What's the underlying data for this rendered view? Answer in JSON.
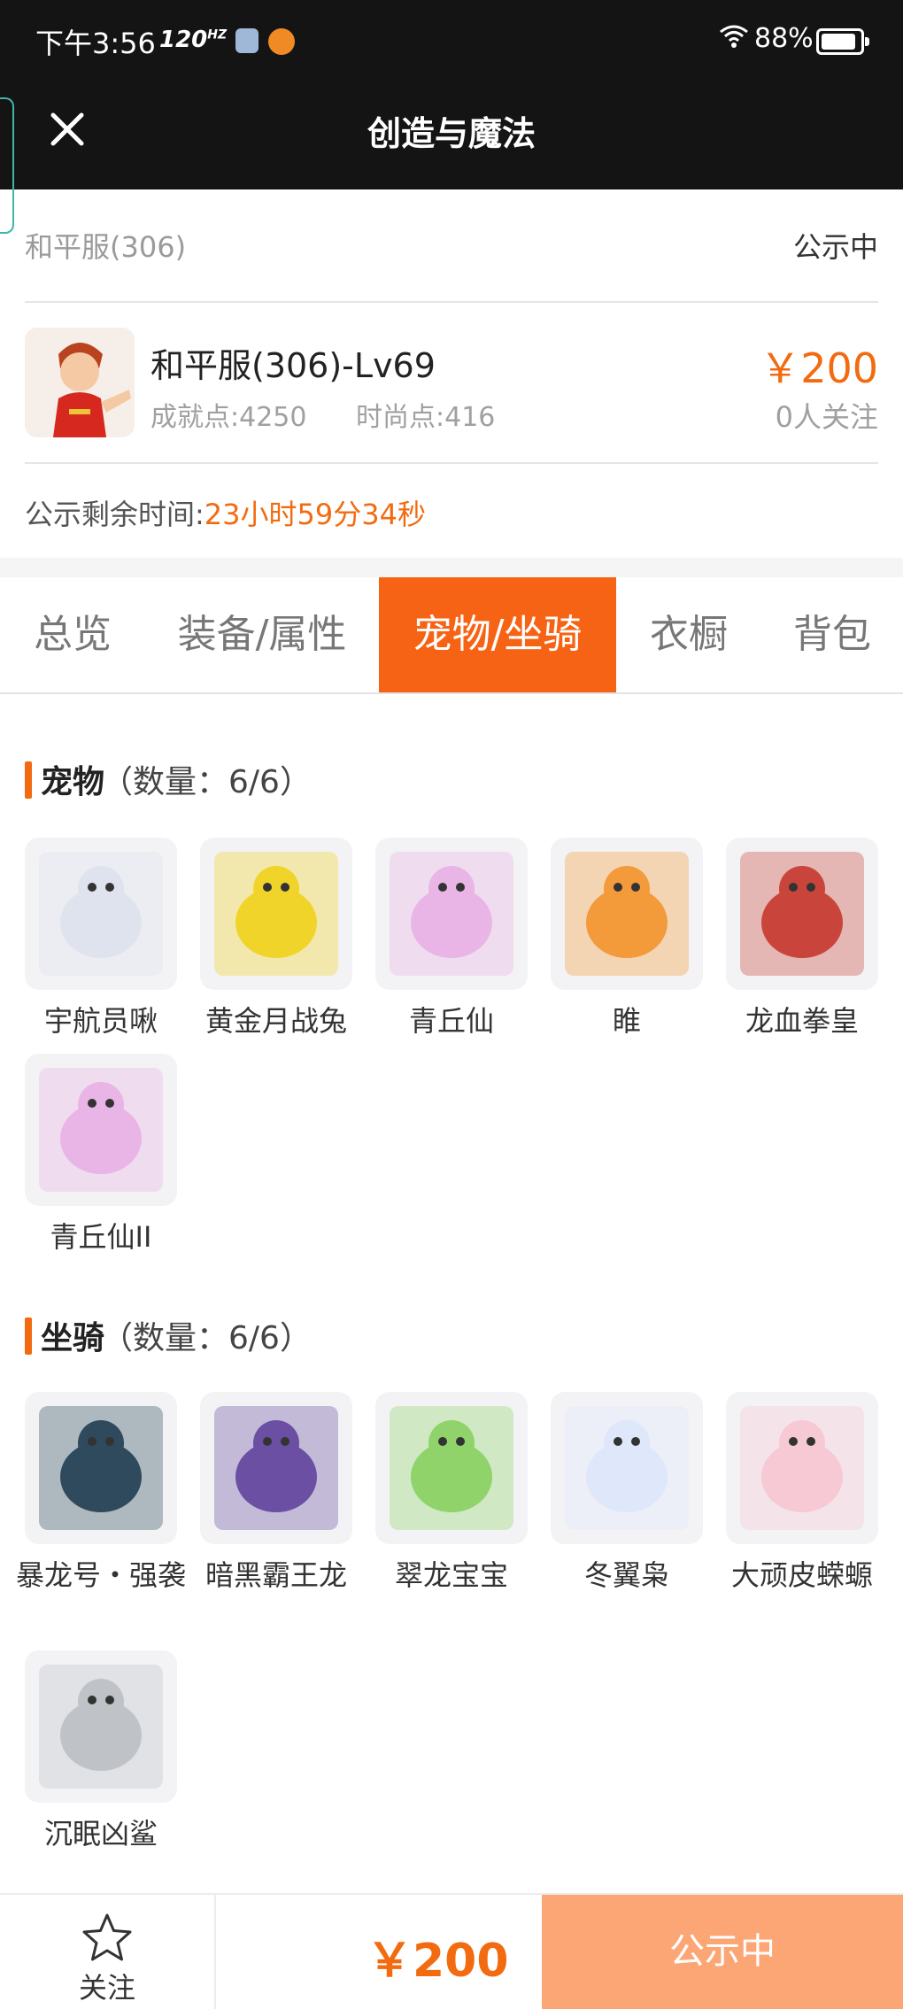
{
  "status_bar": {
    "time": "下午3:56",
    "refresh_rate": "120",
    "battery": "88%"
  },
  "nav": {
    "title": "创造与魔法"
  },
  "listing": {
    "server": "和平服(306)",
    "status": "公示中",
    "character_name": "和平服(306)-Lv69",
    "achievement": "成就点:4250",
    "fashion": "时尚点:416",
    "price": "￥200",
    "followers": "0人关注",
    "countdown_label": "公示剩余时间:",
    "countdown_value": "23小时59分34秒"
  },
  "tabs": [
    {
      "label": "总览",
      "active": false
    },
    {
      "label": "装备/属性",
      "active": false
    },
    {
      "label": "宠物/坐骑",
      "active": true
    },
    {
      "label": "衣橱",
      "active": false
    },
    {
      "label": "背包",
      "active": false
    }
  ],
  "pets": {
    "title": "宠物",
    "count": "（数量：6/6）",
    "items": [
      {
        "name": "宇航员啾",
        "icon": "astronaut-pet-icon",
        "color": "#dfe3ee"
      },
      {
        "name": "黄金月战兔",
        "icon": "golden-rabbit-icon",
        "color": "#f1d42a"
      },
      {
        "name": "青丘仙",
        "icon": "fox-fairy-icon",
        "color": "#e9b4e6"
      },
      {
        "name": "睢",
        "icon": "dragon-icon",
        "color": "#f39a3a"
      },
      {
        "name": "龙血拳皇",
        "icon": "bull-demon-icon",
        "color": "#c9453b"
      },
      {
        "name": "青丘仙II",
        "icon": "fox-fairy-icon",
        "color": "#e9b4e6"
      }
    ]
  },
  "mounts": {
    "title": "坐骑",
    "count": "（数量：6/6）",
    "items": [
      {
        "name": "暴龙号・强袭",
        "icon": "mech-dino-icon",
        "color": "#2f4a5c"
      },
      {
        "name": "暗黑霸王龙",
        "icon": "dark-trex-icon",
        "color": "#6a4fa3"
      },
      {
        "name": "翠龙宝宝",
        "icon": "green-dragon-icon",
        "color": "#8fd36a"
      },
      {
        "name": "冬翼枭",
        "icon": "snow-owl-icon",
        "color": "#dfe7fb"
      },
      {
        "name": "大顽皮蝾螈",
        "icon": "axolotl-icon",
        "color": "#f6c9d4"
      },
      {
        "name": "沉眠凶鲨",
        "icon": "shark-icon",
        "color": "#bfc3c8"
      }
    ]
  },
  "bottom": {
    "follow_label": "关注",
    "price": "￥200",
    "cta": "公示中"
  },
  "colors": {
    "accent": "#f26b10",
    "tab_active": "#f76314",
    "cta_bg": "#fca676",
    "header_bg": "#141414"
  }
}
